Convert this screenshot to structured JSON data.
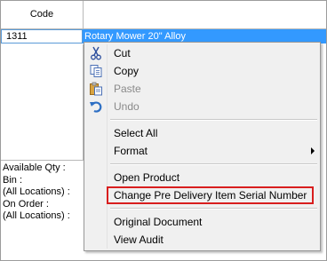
{
  "grid": {
    "columns": {
      "code": "Code"
    },
    "rows": [
      {
        "code": "1311",
        "description": "Rotary Mower 20\" Alloy"
      }
    ]
  },
  "info": {
    "available_qty": "Available Qty :",
    "bin": "Bin :",
    "all_locations_1": "(All Locations) :",
    "on_order": "On Order :",
    "all_locations_2": "(All Locations) :"
  },
  "context_menu": {
    "cut": "Cut",
    "copy": "Copy",
    "paste": "Paste",
    "undo": "Undo",
    "select_all": "Select All",
    "format": "Format",
    "open_product": "Open Product",
    "change_serial": "Change Pre Delivery Item Serial Number",
    "original_document": "Original Document",
    "view_audit": "View Audit"
  },
  "colors": {
    "selection": "#3399ff",
    "highlight_border": "#d81e1e"
  }
}
